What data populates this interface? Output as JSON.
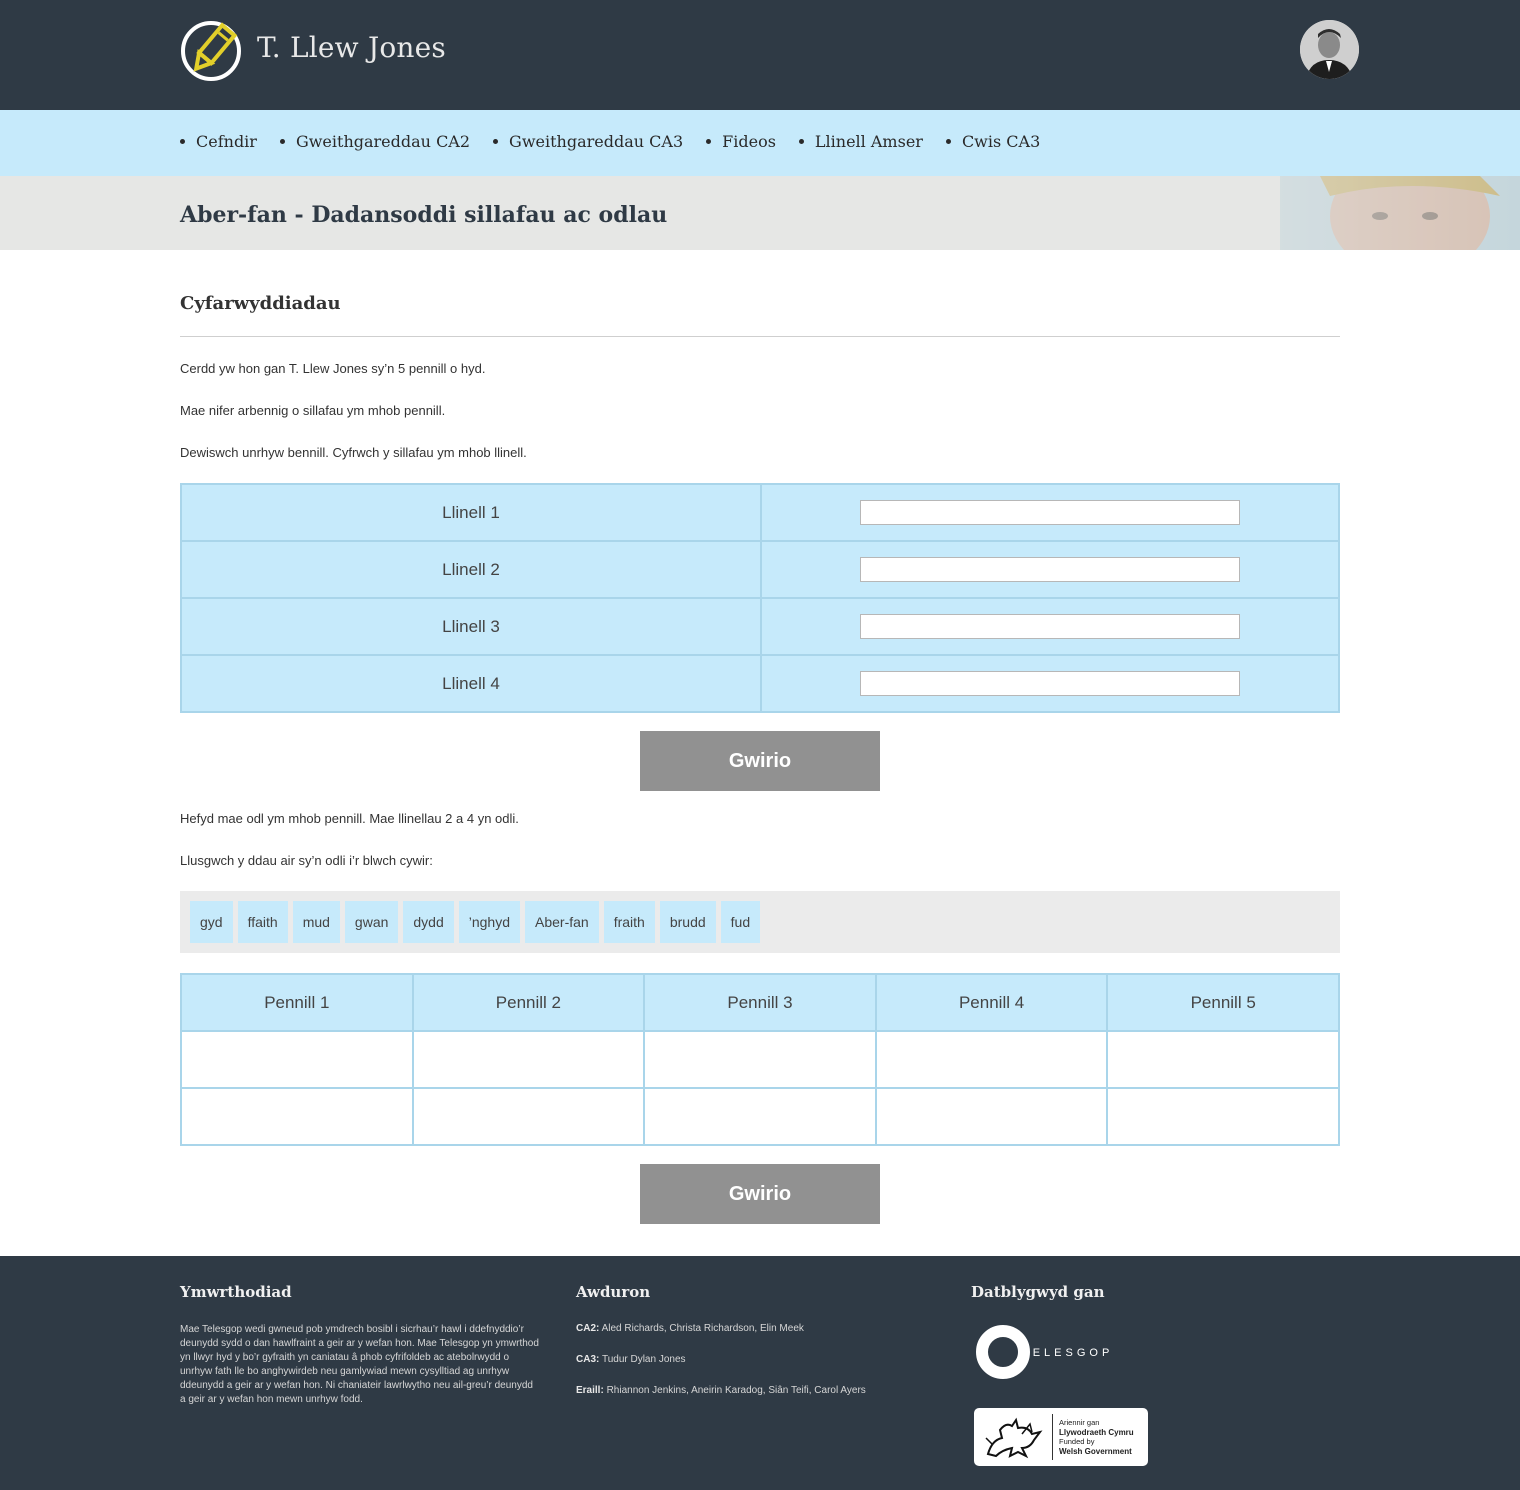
{
  "header": {
    "site_title": "T. Llew Jones",
    "logo_icon": "pencil-circle-logo",
    "avatar_icon": "author-portrait"
  },
  "nav": {
    "items": [
      {
        "label": "Cefndir"
      },
      {
        "label": "Gweithgareddau CA2"
      },
      {
        "label": "Gweithgareddau CA3"
      },
      {
        "label": "Fideos"
      },
      {
        "label": "Llinell Amser"
      },
      {
        "label": "Cwis CA3"
      }
    ]
  },
  "banner": {
    "title": "Aber-fan - Dadansoddi sillafau ac odlau"
  },
  "main": {
    "heading": "Cyfarwyddiadau",
    "intro": [
      "Cerdd yw hon gan T. Llew Jones sy’n 5 pennill o hyd.",
      "Mae nifer arbennig o sillafau ym mhob pennill.",
      "Dewiswch unrhyw bennill. Cyfrwch y sillafau ym mhob llinell."
    ],
    "syllable_rows": [
      {
        "label": "Llinell 1",
        "value": ""
      },
      {
        "label": "Llinell 2",
        "value": ""
      },
      {
        "label": "Llinell 3",
        "value": ""
      },
      {
        "label": "Llinell 4",
        "value": ""
      }
    ],
    "check_label": "Gwirio",
    "rhyme_intro": [
      "Hefyd mae odl ym mhob pennill. Mae llinellau 2 a 4 yn odli.",
      "Llusgwch y ddau air sy’n odli i’r blwch cywir:"
    ],
    "words": [
      "gyd",
      "ffaith",
      "mud",
      "gwan",
      "dydd",
      "’nghyd",
      "Aber-fan",
      "fraith",
      "brudd",
      "fud"
    ],
    "verse_headers": [
      "Pennill 1",
      "Pennill 2",
      "Pennill 3",
      "Pennill 4",
      "Pennill 5"
    ],
    "check_label_2": "Gwirio"
  },
  "footer": {
    "disclaimer_heading": "Ymwrthodiad",
    "disclaimer_text": "Mae Telesgop wedi gwneud pob ymdrech bosibl i sicrhau’r hawl i ddefnyddio’r deunydd sydd o dan hawlfraint a geir ar y wefan hon. Mae Telesgop yn ymwrthod yn llwyr hyd y bo’r gyfraith yn caniatau â phob cyfrifoldeb ac atebolrwydd o unrhyw fath lle bo anghywirdeb neu gamlywiad mewn cysylltiad ag unrhyw ddeunydd a geir ar y wefan hon. Ni chaniateir lawrlwytho neu ail-greu’r deunydd a geir ar y wefan hon mewn unrhyw fodd.",
    "authors_heading": "Awduron",
    "authors": [
      {
        "key": "CA2:",
        "value": "Aled Richards, Christa Richardson, Elin Meek"
      },
      {
        "key": "CA3:",
        "value": "Tudur Dylan Jones"
      },
      {
        "key": "Eraill:",
        "value": "Rhiannon Jenkins, Aneirin Karadog, Siân Teifi, Carol Ayers"
      }
    ],
    "developed_heading": "Datblygwyd gan",
    "telesgop_text": "TELESGOP",
    "wg_line1": "Ariennir gan",
    "wg_line2": "Llywodraeth Cymru",
    "wg_line3": "Funded by",
    "wg_line4": "Welsh Government"
  }
}
